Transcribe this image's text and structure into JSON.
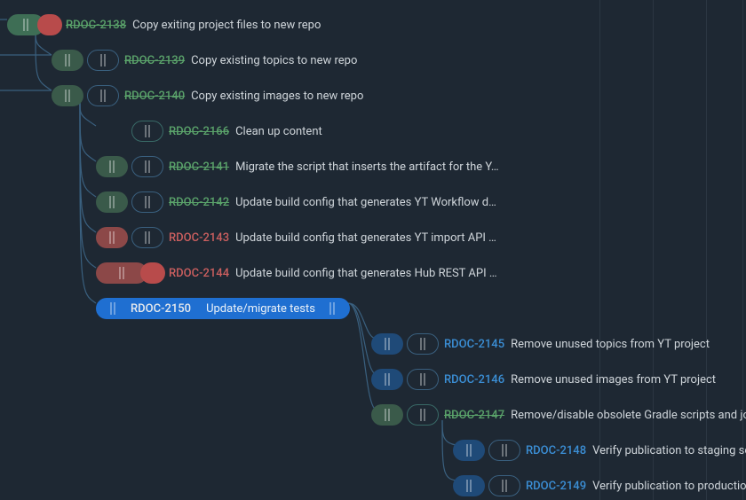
{
  "issues": [
    {
      "id": "RDOC-2138",
      "title": "Copy exiting project files to new repo",
      "status": "done-green"
    },
    {
      "id": "RDOC-2139",
      "title": "Copy existing topics to new repo",
      "status": "done-green"
    },
    {
      "id": "RDOC-2140",
      "title": "Copy existing images to new repo",
      "status": "done-green"
    },
    {
      "id": "RDOC-2166",
      "title": "Clean up content",
      "status": "done-green"
    },
    {
      "id": "RDOC-2141",
      "title": "Migrate the script that inserts the artifact for the Y…",
      "status": "done-green"
    },
    {
      "id": "RDOC-2142",
      "title": "Update build config that generates YT Workflow d…",
      "status": "done-green"
    },
    {
      "id": "RDOC-2143",
      "title": "Update build config that generates YT import API …",
      "status": "open-red"
    },
    {
      "id": "RDOC-2144",
      "title": "Update build config that generates Hub REST API …",
      "status": "open-red"
    },
    {
      "id": "RDOC-2150",
      "title": "Update/migrate tests",
      "status": "selected-blue"
    },
    {
      "id": "RDOC-2145",
      "title": "Remove unused topics from YT project",
      "status": "open-blue"
    },
    {
      "id": "RDOC-2146",
      "title": "Remove unused images from YT project",
      "status": "open-blue"
    },
    {
      "id": "RDOC-2147",
      "title": "Remove/disable obsolete Gradle scripts and jobs f",
      "status": "done-green"
    },
    {
      "id": "RDOC-2148",
      "title": "Verify publication to staging server",
      "status": "open-blue"
    },
    {
      "id": "RDOC-2149",
      "title": "Verify publication to production",
      "status": "open-blue"
    }
  ]
}
